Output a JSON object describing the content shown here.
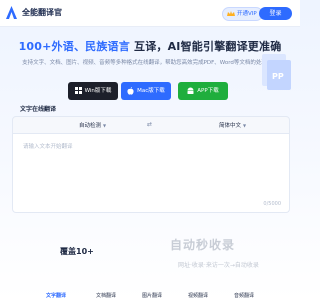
{
  "app": {
    "title": "全能翻译官"
  },
  "header": {
    "vip_label": "开通VIP",
    "login_label": "登录"
  },
  "hero": {
    "title_parts": [
      "100+外语、民族语言",
      " 互译，AI智能引擎翻译更准确"
    ],
    "subtitle": "支持文字、文档、图片、视频、音频等多种格式在线翻译，帮助您高效完成PDF、Word等文档的处理工具"
  },
  "downloads": [
    {
      "label": "Win版下载",
      "icon": "windows-icon",
      "color": "#1c1f2a"
    },
    {
      "label": "Mac版下载",
      "icon": "apple-icon",
      "color": "#2e6bff"
    },
    {
      "label": "APP下载",
      "icon": "android-icon",
      "color": "#1fae3d"
    }
  ],
  "translator": {
    "section_label": "文字在线翻译",
    "source_lang": "自动检测",
    "target_lang": "简体中文",
    "placeholder": "请输入文本开始翻译",
    "counter": "0/5000"
  },
  "features": {
    "title": "覆盖10+",
    "watermark_text": "自动秒收录",
    "watermark_sub": "网址·收录·来访一次→自动收录"
  },
  "tabs": [
    "文字翻译",
    "文档翻译",
    "图片翻译",
    "视频翻译",
    "音频翻译"
  ]
}
